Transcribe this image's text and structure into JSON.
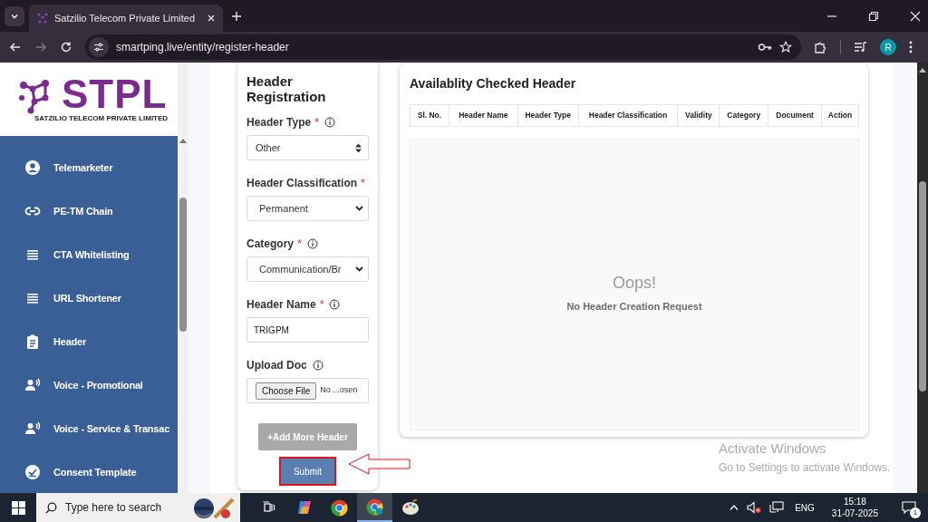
{
  "browser": {
    "tab_title": "Satzilio Telecom Private Limited",
    "url": "smartping.live/entity/register-header",
    "profile_initial": "R"
  },
  "sidebar": {
    "logo": "STPL",
    "logo_tagline": "SATZILIO TELECOM PRIVATE LIMITED",
    "items": [
      {
        "label": "Telemarketer",
        "kind": "account"
      },
      {
        "label": "PE-TM Chain",
        "kind": "chain"
      },
      {
        "label": "CTA Whitelisting",
        "kind": "list"
      },
      {
        "label": "URL Shortener",
        "kind": "list"
      },
      {
        "label": "Header",
        "kind": "clipboard"
      },
      {
        "label": "Voice - Promotional",
        "kind": "voice"
      },
      {
        "label": "Voice - Service & Transac",
        "kind": "voice"
      },
      {
        "label": "Consent Template",
        "kind": "consent"
      }
    ]
  },
  "form": {
    "title": "Header Registration",
    "fields": [
      {
        "label": "Header Type",
        "required_mark": "*",
        "info": true,
        "kind": "spinner",
        "value": "Other"
      },
      {
        "label": "Header Classification",
        "required_mark": "*",
        "info": false,
        "kind": "select",
        "value": "Permanent"
      },
      {
        "label": "Category",
        "required_mark": "*",
        "info": true,
        "kind": "select",
        "value": "Communication/Br"
      },
      {
        "label": "Header Name",
        "required_mark": "*",
        "info": true,
        "kind": "text",
        "value": "TRIGPM"
      },
      {
        "label": "Upload Doc",
        "info": true,
        "kind": "file",
        "button": "Choose File",
        "value": "No ...osen"
      }
    ],
    "add_button": {
      "label": "+Add More Header",
      "disabled": true
    },
    "submit_button": {
      "label": "Submit",
      "highlighted": true
    }
  },
  "table": {
    "title": "Availablity Checked Header",
    "columns": [
      "Sl. No.",
      "Header Name",
      "Header Type",
      "Header Classification",
      "Validity",
      "Category",
      "Document",
      "Action"
    ],
    "empty": {
      "title": "Oops!",
      "message": "No Header Creation Request"
    }
  },
  "activation": {
    "title": "Activate Windows",
    "subtitle": "Go to Settings to activate Windows."
  },
  "taskbar": {
    "search_placeholder": "Type here to search",
    "language": "ENG",
    "time": "15:18",
    "date": "31-07-2025",
    "notifications": "1"
  }
}
